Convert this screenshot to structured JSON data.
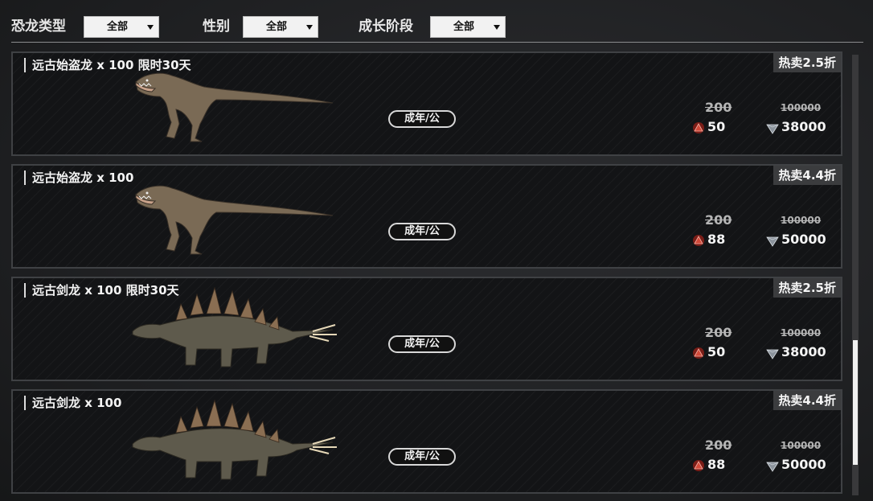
{
  "filters": {
    "dino_type": {
      "label": "恐龙类型",
      "value": "全部"
    },
    "gender": {
      "label": "性别",
      "value": "全部"
    },
    "growth_stage": {
      "label": "成长阶段",
      "value": "全部"
    }
  },
  "items": [
    {
      "title": "远古始盗龙 x 100 限时30天",
      "badge": "热卖2.5折",
      "stage": "成年/公",
      "orig_price_a": "200",
      "price_a": "50",
      "orig_price_b": "100000",
      "price_b": "38000",
      "dino": "raptor"
    },
    {
      "title": "远古始盗龙 x 100",
      "badge": "热卖4.4折",
      "stage": "成年/公",
      "orig_price_a": "200",
      "price_a": "88",
      "orig_price_b": "100000",
      "price_b": "50000",
      "dino": "raptor"
    },
    {
      "title": "远古剑龙 x 100 限时30天",
      "badge": "热卖2.5折",
      "stage": "成年/公",
      "orig_price_a": "200",
      "price_a": "50",
      "orig_price_b": "100000",
      "price_b": "38000",
      "dino": "stegosaurus"
    },
    {
      "title": "远古剑龙 x 100",
      "badge": "热卖4.4折",
      "stage": "成年/公",
      "orig_price_a": "200",
      "price_a": "88",
      "orig_price_b": "100000",
      "price_b": "50000",
      "dino": "stegosaurus"
    }
  ],
  "icons": {
    "currency_a": "red-triangle-gem-icon",
    "currency_b": "silver-diamond-icon",
    "dropdown": "caret-down-icon"
  },
  "colors": {
    "currency_a": "#c0392b",
    "currency_b": "#9aa3ad",
    "badge_bg": "#3b3c3e"
  }
}
